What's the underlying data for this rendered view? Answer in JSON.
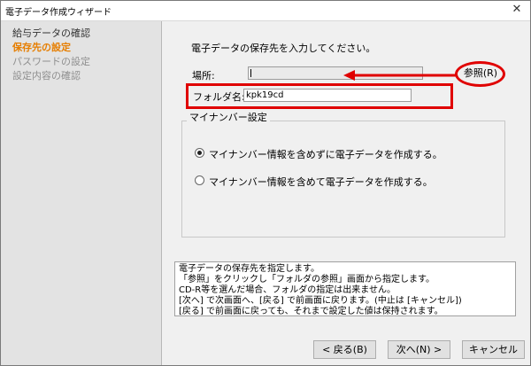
{
  "window": {
    "title": "電子データ作成ウィザード",
    "close_glyph": "✕"
  },
  "sidebar": {
    "steps": [
      {
        "label": "給与データの確認",
        "state": "done"
      },
      {
        "label": "保存先の設定",
        "state": "active"
      },
      {
        "label": "パスワードの設定",
        "state": "disabled"
      },
      {
        "label": "設定内容の確認",
        "state": "disabled"
      }
    ]
  },
  "main": {
    "instruction": "電子データの保存先を入力してください。",
    "location_label": "場所:",
    "location_value": "",
    "browse_label": "参照(R)",
    "folder_label": "フォルダ名:",
    "folder_value": "kpk19cd",
    "group_title": "マイナンバー設定",
    "options": [
      {
        "label": "マイナンバー情報を含めずに電子データを作成する。",
        "selected": true
      },
      {
        "label": "マイナンバー情報を含めて電子データを作成する。",
        "selected": false
      }
    ]
  },
  "help": {
    "lines": [
      "電子データの保存先を指定します。",
      "「参照」をクリックし「フォルダの参照」画面から指定します。",
      "CD-R等を選んだ場合、フォルダの指定は出来ません。",
      "[次へ] で次画面へ、[戻る] で前画面に戻ります。(中止は [キャンセル])",
      "[戻る] で前画面に戻っても、それまで設定した値は保持されます。"
    ]
  },
  "buttons": {
    "back": "< 戻る(B)",
    "next": "次へ(N) >",
    "cancel": "キャンセル"
  },
  "annotation_color": "#e00000"
}
